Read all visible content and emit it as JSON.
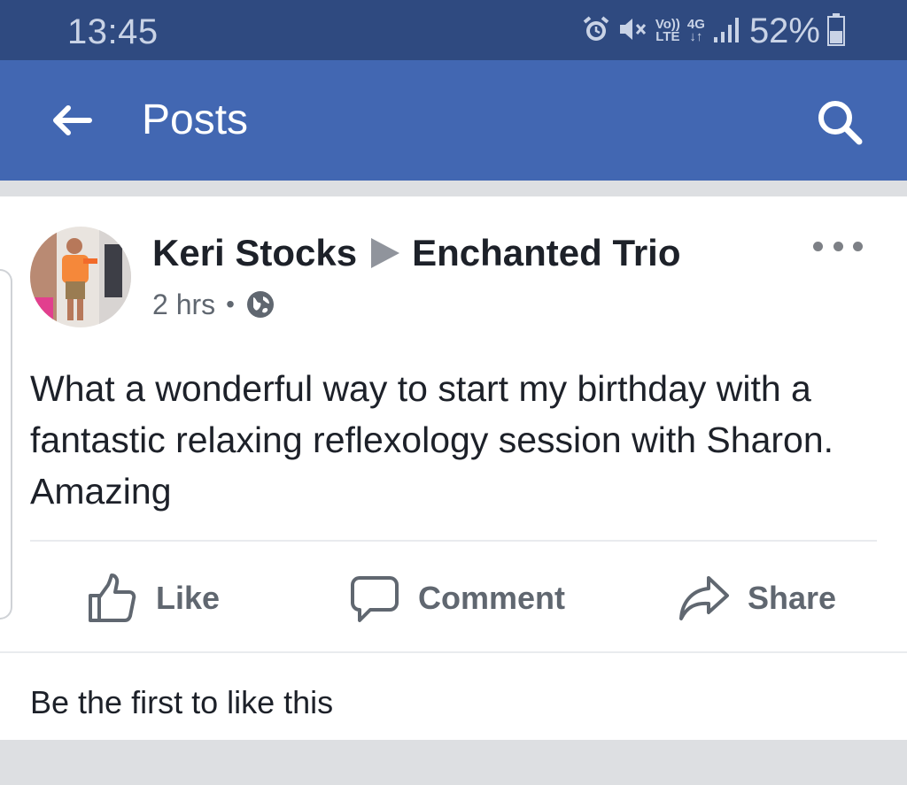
{
  "status_bar": {
    "time": "13:45",
    "network_top": "Vo))",
    "network_bottom": "LTE",
    "signal_type": "4G",
    "battery_percent": "52%",
    "icons": [
      "alarm-icon",
      "mute-icon",
      "volte-icon",
      "data-arrows-icon",
      "signal-icon",
      "battery-icon"
    ]
  },
  "app_bar": {
    "back_icon": "arrow-left-icon",
    "title": "Posts",
    "search_icon": "search-icon"
  },
  "post": {
    "author": "Keri Stocks",
    "group": "Enchanted Trio",
    "time": "2 hrs",
    "separator": "•",
    "privacy_icon": "globe-icon",
    "more_icon": "more-dots-icon",
    "text": "What a wonderful way to start my birthday with a fantastic relaxing reflexology session with Sharon. Amazing",
    "actions": {
      "like": "Like",
      "comment": "Comment",
      "share": "Share"
    },
    "like_summary": "Be the first to like this"
  },
  "colors": {
    "status_bar": "#2f4a80",
    "app_bar": "#4267b2",
    "background": "#dddfe2",
    "text_primary": "#1d2129",
    "text_secondary": "#606770"
  }
}
